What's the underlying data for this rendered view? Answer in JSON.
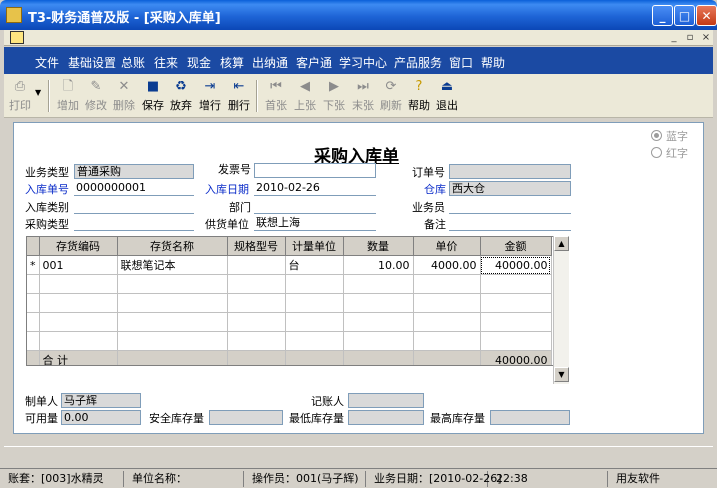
{
  "window": {
    "title": "T3-财务通普及版 - [采购入库单]"
  },
  "menu": [
    "文件",
    "基础设置",
    "总账",
    "往来",
    "现金",
    "核算",
    "出纳通",
    "客户通",
    "学习中心",
    "产品服务",
    "窗口",
    "帮助"
  ],
  "toolbar": {
    "print": "打印",
    "add": "增加",
    "edit": "修改",
    "delete": "删除",
    "save": "保存",
    "discard": "放弃",
    "add_row": "增行",
    "del_row": "删行",
    "first": "首张",
    "prev": "上张",
    "next": "下张",
    "last": "末张",
    "refresh": "刷新",
    "help": "帮助",
    "exit": "退出"
  },
  "form": {
    "title": "采购入库单",
    "radio_blue": "蓝字",
    "radio_red": "红字",
    "business_type_label": "业务类型",
    "business_type": "普通采购",
    "invoice_no_label": "发票号",
    "invoice_no": "",
    "order_no_label": "订单号",
    "order_no": "",
    "receipt_no_label": "入库单号",
    "receipt_no": "0000000001",
    "receipt_date_label": "入库日期",
    "receipt_date": "2010-02-26",
    "warehouse_label": "仓库",
    "warehouse": "西大仓",
    "receipt_category_label": "入库类别",
    "receipt_category": "",
    "department_label": "部门",
    "department": "",
    "salesperson_label": "业务员",
    "salesperson": "",
    "purchase_type_label": "采购类型",
    "purchase_type": "",
    "supplier_label": "供货单位",
    "supplier": "联想上海",
    "remark_label": "备注",
    "remark": ""
  },
  "grid": {
    "columns": [
      "存货编码",
      "存货名称",
      "规格型号",
      "计量单位",
      "数量",
      "单价",
      "金额"
    ],
    "rows": [
      {
        "marker": "*",
        "code": "001",
        "name": "联想笔记本",
        "spec": "",
        "unit": "台",
        "qty": "10.00",
        "price": "4000.00",
        "amount": "40000.00"
      }
    ],
    "total_label": "合  计",
    "total_amount": "40000.00"
  },
  "footer": {
    "maker_label": "制单人",
    "maker": "马子辉",
    "bookkeeper_label": "记账人",
    "bookkeeper": "",
    "available_label": "可用量",
    "available": "0.00",
    "safety_stock_label": "安全库存量",
    "safety_stock": "",
    "min_stock_label": "最低库存量",
    "min_stock": "",
    "max_stock_label": "最高库存量",
    "max_stock": ""
  },
  "status": {
    "account": "账套：[003]水精灵",
    "unit": "单位名称：",
    "operator": "操作员：001(马子辉)",
    "biz_date": "业务日期：[2010-02-26]",
    "time": "22:38",
    "vendor": "用友软件"
  }
}
